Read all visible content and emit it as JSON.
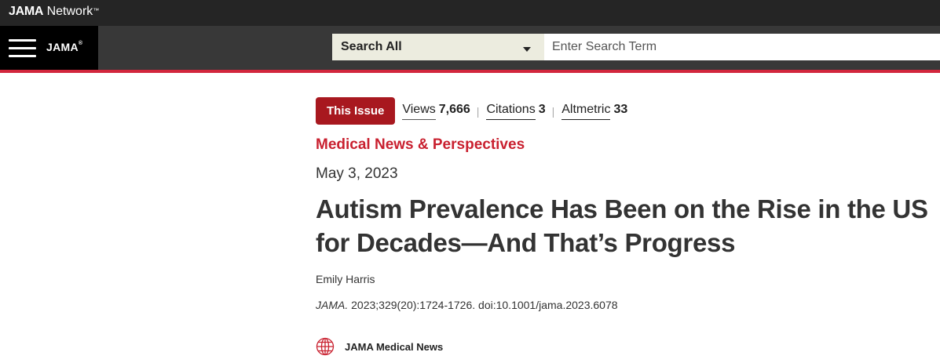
{
  "network": {
    "brand_bold": "JAMA",
    "brand_light": "Network",
    "trademark": "™"
  },
  "header": {
    "journal_logo": "JAMA",
    "logo_mark": "®",
    "search_scope": "Search All",
    "search_placeholder": "Enter Search Term",
    "search_value": ""
  },
  "article": {
    "issue_badge": "This Issue",
    "metrics": [
      {
        "label": "Views",
        "value": "7,666"
      },
      {
        "label": "Citations",
        "value": "3"
      },
      {
        "label": "Altmetric",
        "value": "33"
      }
    ],
    "separator": "|",
    "section": "Medical News & Perspectives",
    "date": "May 3, 2023",
    "title": "Autism Prevalence Has Been on the Rise in the US for Decades—And That’s Progress",
    "author": "Emily Harris",
    "citation_journal": "JAMA.",
    "citation_details": " 2023;329(20):1724-1726. doi:10.1001/jama.2023.6078",
    "news_source": "JAMA Medical News"
  },
  "colors": {
    "accent_red": "#d2263d",
    "badge_red": "#a8181f",
    "section_red": "#c9202f",
    "header_dark": "#383838",
    "network_bar": "#252525"
  },
  "icons": {
    "menu": "hamburger-menu-icon",
    "caret": "caret-down-icon",
    "globe": "globe-icon"
  }
}
